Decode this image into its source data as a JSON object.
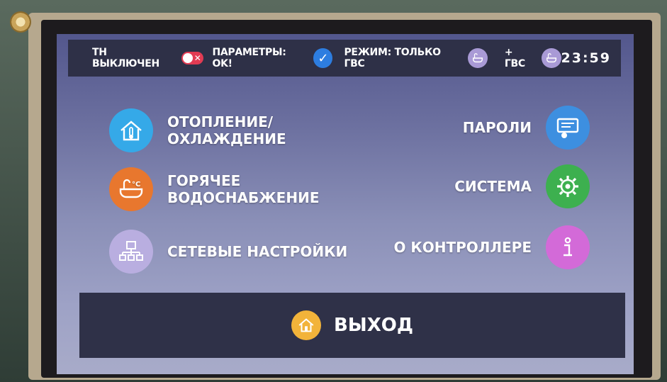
{
  "status": {
    "heat_pump": "ТН ВЫКЛЮЧЕН",
    "toggle_glyph": "✕",
    "params_label": "ПАРАМЕТРЫ: OK!",
    "check_glyph": "✓",
    "mode_label": "РЕЖИМ: ТОЛЬКО ГВС",
    "dhw_label": "+ ГВС",
    "time": "23:59"
  },
  "menu": {
    "heating": {
      "line1": "ОТОПЛЕНИЕ/",
      "line2": "ОХЛАЖДЕНИЕ",
      "icon": "house-thermometer-icon",
      "color": "#35a9e8"
    },
    "hot_water": {
      "line1": "ГОРЯЧЕЕ",
      "line2": "ВОДОСНАБЖЕНИЕ",
      "icon": "bathtub-icon",
      "color": "#e8772e"
    },
    "network": {
      "label": "СЕТЕВЫЕ НАСТРОЙКИ",
      "icon": "network-icon",
      "color": "#b9aee0"
    },
    "passwords": {
      "label": "ПАРОЛИ",
      "icon": "password-keypad-icon",
      "color": "#3d8fe0"
    },
    "system": {
      "label": "СИСТЕМА",
      "icon": "gear-icon",
      "color": "#3db04f"
    },
    "about": {
      "label": "О КОНТРОЛЛЕРЕ",
      "icon": "info-icon",
      "color": "#d36ad8"
    }
  },
  "exit": {
    "label": "ВЫХОД",
    "icon": "home-icon",
    "color": "#f2b33a"
  }
}
